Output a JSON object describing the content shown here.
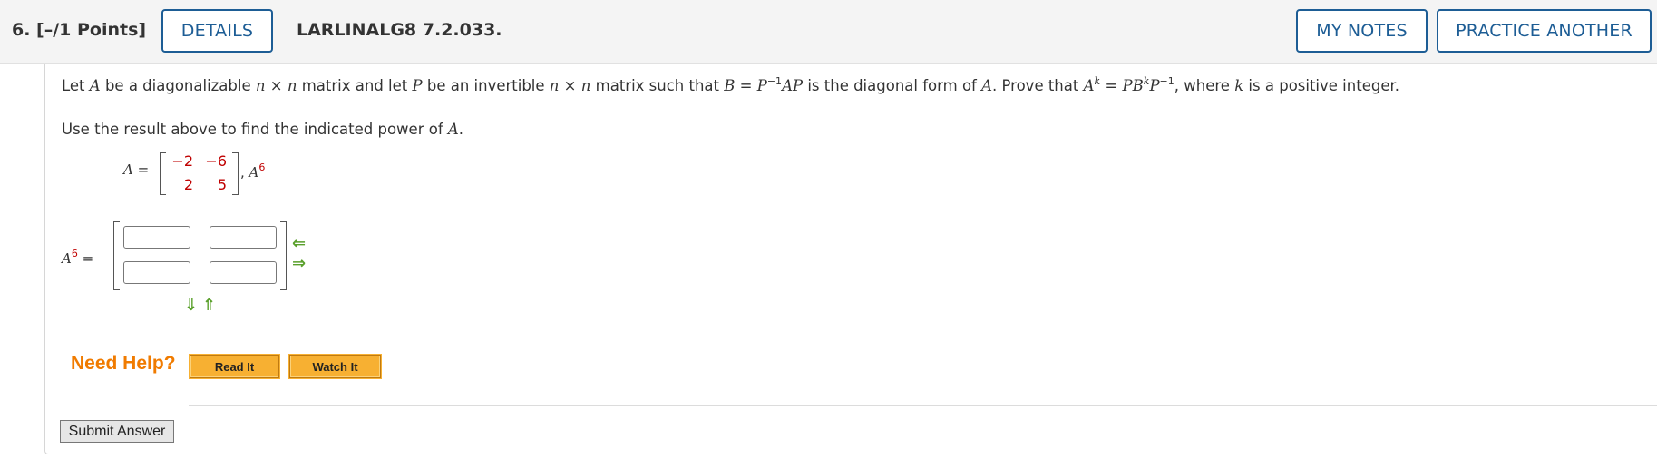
{
  "header": {
    "question_number": "6.  [–/1 Points]",
    "details_label": "DETAILS",
    "assignment_id": "LARLINALG8 7.2.033.",
    "my_notes_label": "MY NOTES",
    "practice_label": "PRACTICE ANOTHER"
  },
  "problem": {
    "statement_parts": {
      "p1": "Let ",
      "A": "A",
      "p2": " be a diagonalizable ",
      "n1": "n",
      "times1": " × ",
      "n2": "n",
      "p3": " matrix and let ",
      "P": "P",
      "p4": " be an invertible ",
      "n3": "n",
      "times2": " × ",
      "n4": "n",
      "p5": " matrix such that  ",
      "B": "B",
      "eq1": " = ",
      "P1": "P",
      "inv1": "−1",
      "AP": "AP",
      "p6": "  is the diagonal form of ",
      "A2": "A",
      "p7": ". Prove that  ",
      "A3": "A",
      "k1": "k",
      "eq2": " = ",
      "PB": "PB",
      "k2": "k",
      "P2": "P",
      "inv2": "−1",
      "p8": ",  where ",
      "k3": "k",
      "p9": " is a positive integer."
    },
    "instruction": "Use the result above to find the indicated power of ",
    "instruction_var": "A",
    "instruction_end": ".",
    "matrix_label": "A",
    "matrix_eq": " =",
    "matrix": [
      [
        "−2",
        "−6"
      ],
      [
        "2",
        "5"
      ]
    ],
    "power_sep": ", ",
    "power_var": "A",
    "power_exp": "6"
  },
  "answer": {
    "label_var": "A",
    "label_exp": "6",
    "label_eq": " =",
    "inputs": [
      "",
      "",
      "",
      ""
    ]
  },
  "help": {
    "need_help": "Need Help?",
    "read_it": "Read It",
    "watch_it": "Watch It"
  },
  "submit_label": "Submit Answer",
  "colors": {
    "accent": "#1d5d95",
    "need_help": "#f07b00",
    "help_button": "#f7b032",
    "matrix_values": "#c00000",
    "arrows": "#5aa02c"
  }
}
